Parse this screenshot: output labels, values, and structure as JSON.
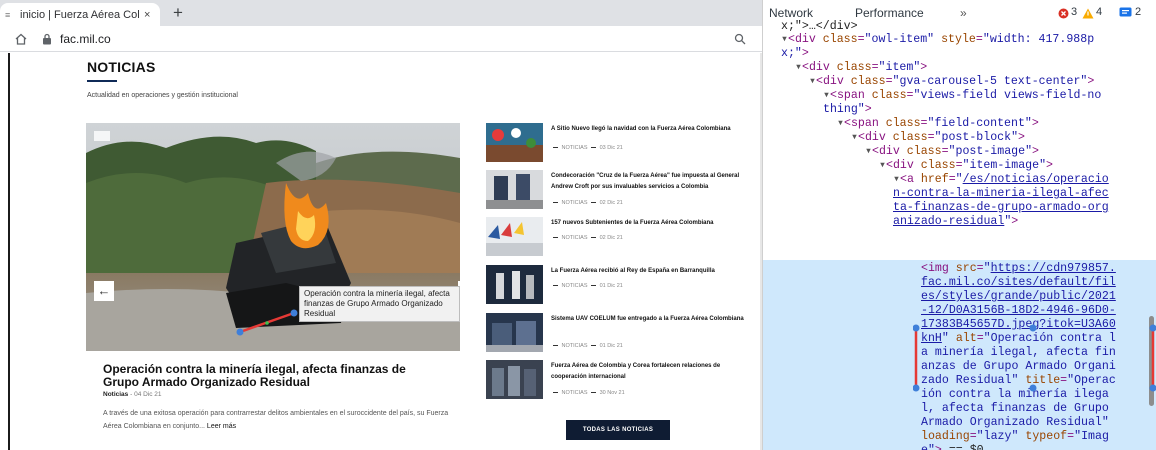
{
  "browser": {
    "tab_title": "inicio | Fuerza Aérea Colombia",
    "tab_close": "×",
    "new_tab": "+",
    "url": "fac.mil.co",
    "favicon": "≡"
  },
  "page": {
    "section_title": "NOTICIAS",
    "section_subtitle": "Actualidad en operaciones y gestión institucional",
    "hero_prev": "←",
    "tooltip": "Operación contra la minería ilegal, afecta finanzas de Grupo Armado Organizado Residual",
    "main_article": {
      "title": "Operación contra la minería ilegal, afecta finanzas de Grupo Armado Organizado Residual",
      "category": "Noticias",
      "date": " - 04 Dic 21",
      "summary": "A través de una exitosa operación para contrarrestar delitos ambientales en el suroccidente del país, su Fuerza Aérea Colombiana en conjunto...",
      "read_more": "Leer más"
    },
    "side_news": [
      {
        "title": "A Sitio Nuevo llegó la navidad con la Fuerza Aérea Colombiana",
        "category": "NOTICIAS",
        "date": "03 Dic 21"
      },
      {
        "title": "Condecoración \"Cruz de la Fuerza Aérea\" fue impuesta al General Andrew Croft por sus invaluables servicios a Colombia",
        "category": "NOTICIAS",
        "date": "02 Dic 21"
      },
      {
        "title": "157 nuevos Subtenientes de la Fuerza Aérea Colombiana",
        "category": "NOTICIAS",
        "date": "02 Dic 21"
      },
      {
        "title": "La Fuerza Aérea recibió al Rey de España en Barranquilla",
        "category": "NOTICIAS",
        "date": "01 Dic 21"
      },
      {
        "title": "Sistema UAV COELUM fue entregado a la Fuerza Aérea Colombiana",
        "category": "NOTICIAS",
        "date": "01 Dic 21"
      },
      {
        "title": "Fuerza Aérea de Colombia y Corea fortalecen relaciones de cooperación internacional",
        "category": "NOTICIAS",
        "date": "30 Nov 21"
      }
    ],
    "all_news_button": "TODAS LAS NOTICIAS"
  },
  "devtools": {
    "tabs": [
      "Network",
      "Performance"
    ],
    "more_tabs": "»",
    "error_count": "3",
    "warning_count": "4",
    "message_count": "2"
  },
  "colors": {
    "navy": "#0f1c33",
    "selection": "#cfe8fc",
    "tag": "#881280",
    "attr_name": "#994500",
    "attr_value": "#1a1aa6"
  }
}
